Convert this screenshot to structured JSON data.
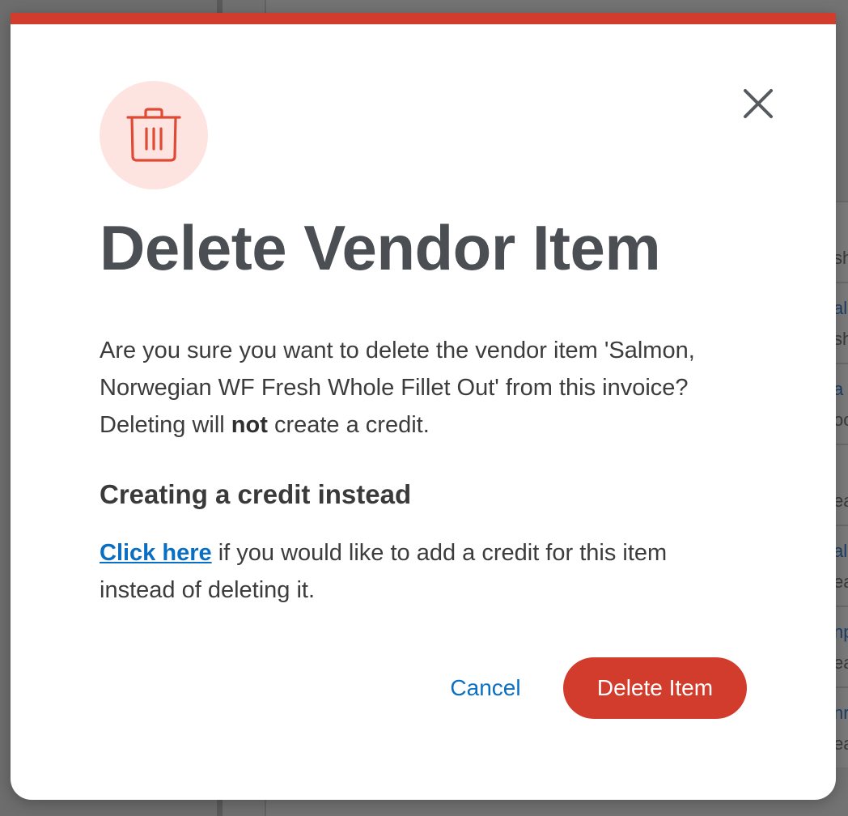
{
  "dialog": {
    "title": "Delete Vendor Item",
    "body_before": "Are you sure you want to delete the vendor item 'Salmon, Norwegian WF Fresh Whole Fillet Out' from this invoice? Deleting will ",
    "body_emphasis": "not",
    "body_after": " create a credit.",
    "section_title": "Creating a credit instead",
    "credit_link_label": "Click here",
    "credit_text": " if you would like to add a credit for this item instead of deleting it.",
    "cancel_label": "Cancel",
    "delete_label": "Delete Item",
    "icon": "trash-icon",
    "close_icon": "close-icon"
  },
  "background_rows": [
    {
      "line1": "",
      "line2": "sh"
    },
    {
      "line1": "alm",
      "line2": "sh"
    },
    {
      "line1": "a",
      "line2": "oc"
    },
    {
      "line1": "",
      "line2": "ea"
    },
    {
      "line1": "alm",
      "line2": "ea"
    },
    {
      "line1": "np",
      "line2": "ea"
    },
    {
      "line1": "nr",
      "line2": "ea"
    }
  ],
  "colors": {
    "accent_red": "#d23c2d",
    "icon_bg": "#fde4e1",
    "link_blue": "#0a6fc2",
    "title_gray": "#4b4f54"
  }
}
